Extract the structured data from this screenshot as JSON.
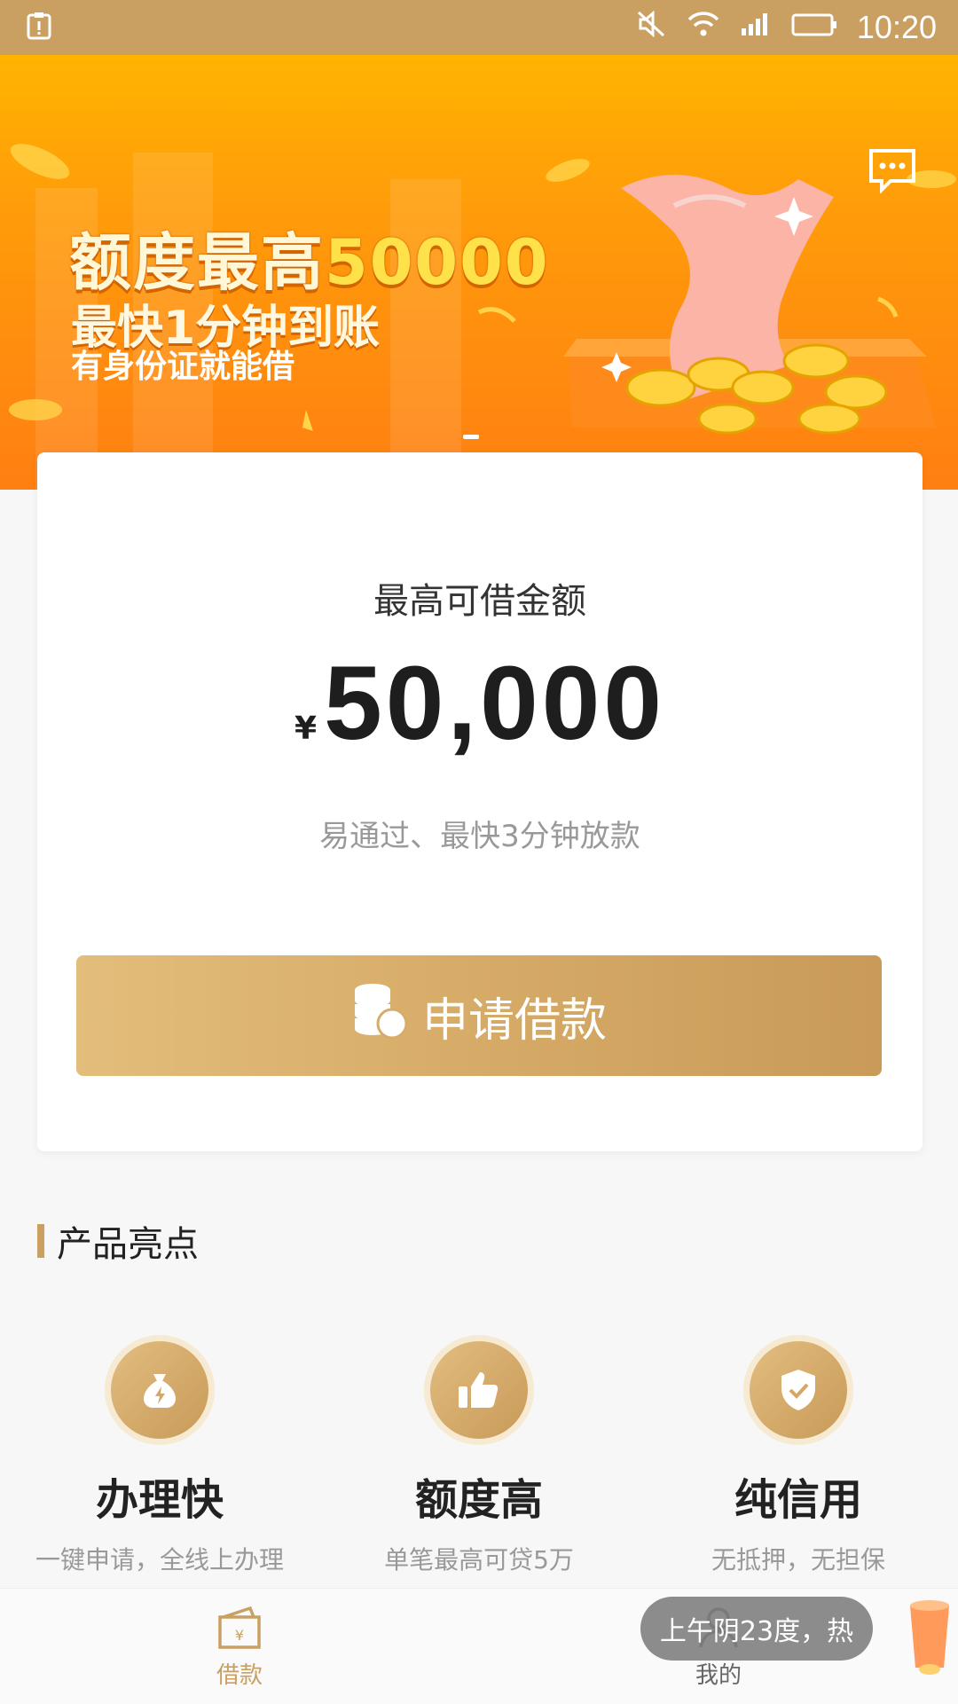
{
  "status_bar": {
    "time": "10:20"
  },
  "banner": {
    "title_prefix": "额度最高",
    "title_number": "50000",
    "subtitle": "最快1分钟到账",
    "tagline": "有身份证就能借"
  },
  "loan_card": {
    "label": "最高可借金额",
    "currency": "¥",
    "amount": "50,000",
    "description": "易通过、最快3分钟放款",
    "apply_button": "申请借款"
  },
  "highlights": {
    "title": "产品亮点",
    "items": [
      {
        "title": "办理快",
        "subtitle": "一键申请，全线上办理",
        "icon": "money-bag-bolt-icon"
      },
      {
        "title": "额度高",
        "subtitle": "单笔最高可贷5万",
        "icon": "thumbs-up-icon"
      },
      {
        "title": "纯信用",
        "subtitle": "无抵押，无担保",
        "icon": "shield-check-icon"
      }
    ]
  },
  "tabbar": {
    "tabs": [
      {
        "label": "借款",
        "icon": "wallet-yen-icon",
        "active": true
      },
      {
        "label": "我的",
        "icon": "person-icon",
        "active": false
      }
    ]
  },
  "toast": {
    "text": "上午阴23度，热"
  },
  "colors": {
    "accent": "#c9a062",
    "banner": "#ff9c0a"
  }
}
